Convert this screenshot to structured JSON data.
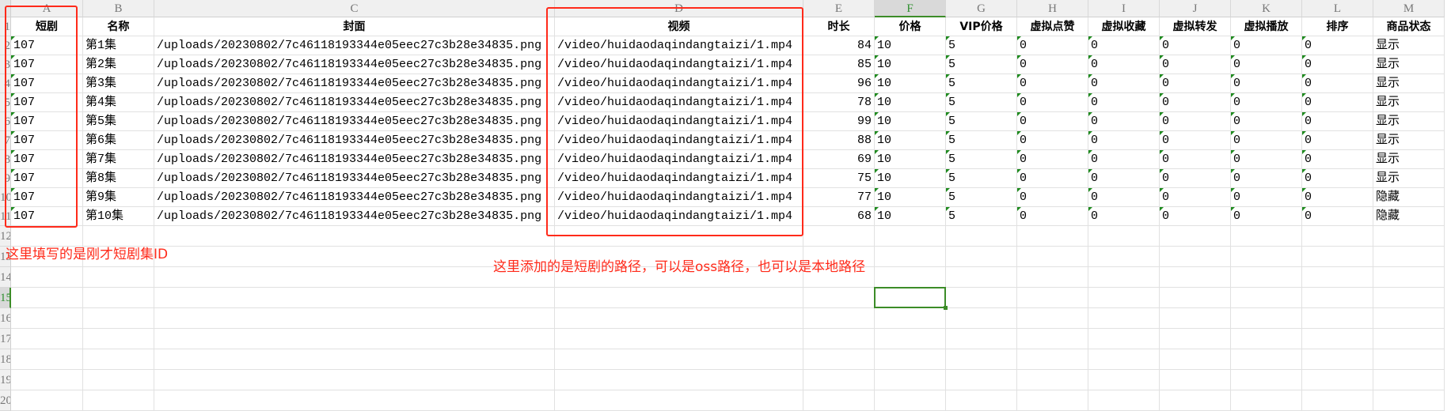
{
  "columns": [
    "A",
    "B",
    "C",
    "D",
    "E",
    "F",
    "G",
    "H",
    "I",
    "J",
    "K",
    "L",
    "M"
  ],
  "selected_column": "F",
  "selected_row": 15,
  "headers": [
    "短剧",
    "名称",
    "封面",
    "视频",
    "时长",
    "价格",
    "VIP价格",
    "虚拟点赞",
    "虚拟收藏",
    "虚拟转发",
    "虚拟播放",
    "排序",
    "商品状态"
  ],
  "rows": [
    [
      "107",
      "第1集",
      "/uploads/20230802/7c46118193344e05eec27c3b28e34835.png",
      "/video/huidaodaqindangtaizi/1.mp4",
      "84",
      "10",
      "5",
      "0",
      "0",
      "0",
      "0",
      "0",
      "显示"
    ],
    [
      "107",
      "第2集",
      "/uploads/20230802/7c46118193344e05eec27c3b28e34835.png",
      "/video/huidaodaqindangtaizi/1.mp4",
      "85",
      "10",
      "5",
      "0",
      "0",
      "0",
      "0",
      "0",
      "显示"
    ],
    [
      "107",
      "第3集",
      "/uploads/20230802/7c46118193344e05eec27c3b28e34835.png",
      "/video/huidaodaqindangtaizi/1.mp4",
      "96",
      "10",
      "5",
      "0",
      "0",
      "0",
      "0",
      "0",
      "显示"
    ],
    [
      "107",
      "第4集",
      "/uploads/20230802/7c46118193344e05eec27c3b28e34835.png",
      "/video/huidaodaqindangtaizi/1.mp4",
      "78",
      "10",
      "5",
      "0",
      "0",
      "0",
      "0",
      "0",
      "显示"
    ],
    [
      "107",
      "第5集",
      "/uploads/20230802/7c46118193344e05eec27c3b28e34835.png",
      "/video/huidaodaqindangtaizi/1.mp4",
      "99",
      "10",
      "5",
      "0",
      "0",
      "0",
      "0",
      "0",
      "显示"
    ],
    [
      "107",
      "第6集",
      "/uploads/20230802/7c46118193344e05eec27c3b28e34835.png",
      "/video/huidaodaqindangtaizi/1.mp4",
      "88",
      "10",
      "5",
      "0",
      "0",
      "0",
      "0",
      "0",
      "显示"
    ],
    [
      "107",
      "第7集",
      "/uploads/20230802/7c46118193344e05eec27c3b28e34835.png",
      "/video/huidaodaqindangtaizi/1.mp4",
      "69",
      "10",
      "5",
      "0",
      "0",
      "0",
      "0",
      "0",
      "显示"
    ],
    [
      "107",
      "第8集",
      "/uploads/20230802/7c46118193344e05eec27c3b28e34835.png",
      "/video/huidaodaqindangtaizi/1.mp4",
      "75",
      "10",
      "5",
      "0",
      "0",
      "0",
      "0",
      "0",
      "显示"
    ],
    [
      "107",
      "第9集",
      "/uploads/20230802/7c46118193344e05eec27c3b28e34835.png",
      "/video/huidaodaqindangtaizi/1.mp4",
      "77",
      "10",
      "5",
      "0",
      "0",
      "0",
      "0",
      "0",
      "隐藏"
    ],
    [
      "107",
      "第10集",
      "/uploads/20230802/7c46118193344e05eec27c3b28e34835.png",
      "/video/huidaodaqindangtaizi/1.mp4",
      "68",
      "10",
      "5",
      "0",
      "0",
      "0",
      "0",
      "0",
      "隐藏"
    ]
  ],
  "annotations": {
    "id_note": "这里填写的是刚才短剧集ID",
    "video_note": "这里添加的是短剧的路径，可以是oss路径，也可以是本地路径"
  },
  "colors": {
    "annotation": "#ff2a1a",
    "selection": "#3c8c28",
    "error_indicator": "#1e8a1e"
  }
}
